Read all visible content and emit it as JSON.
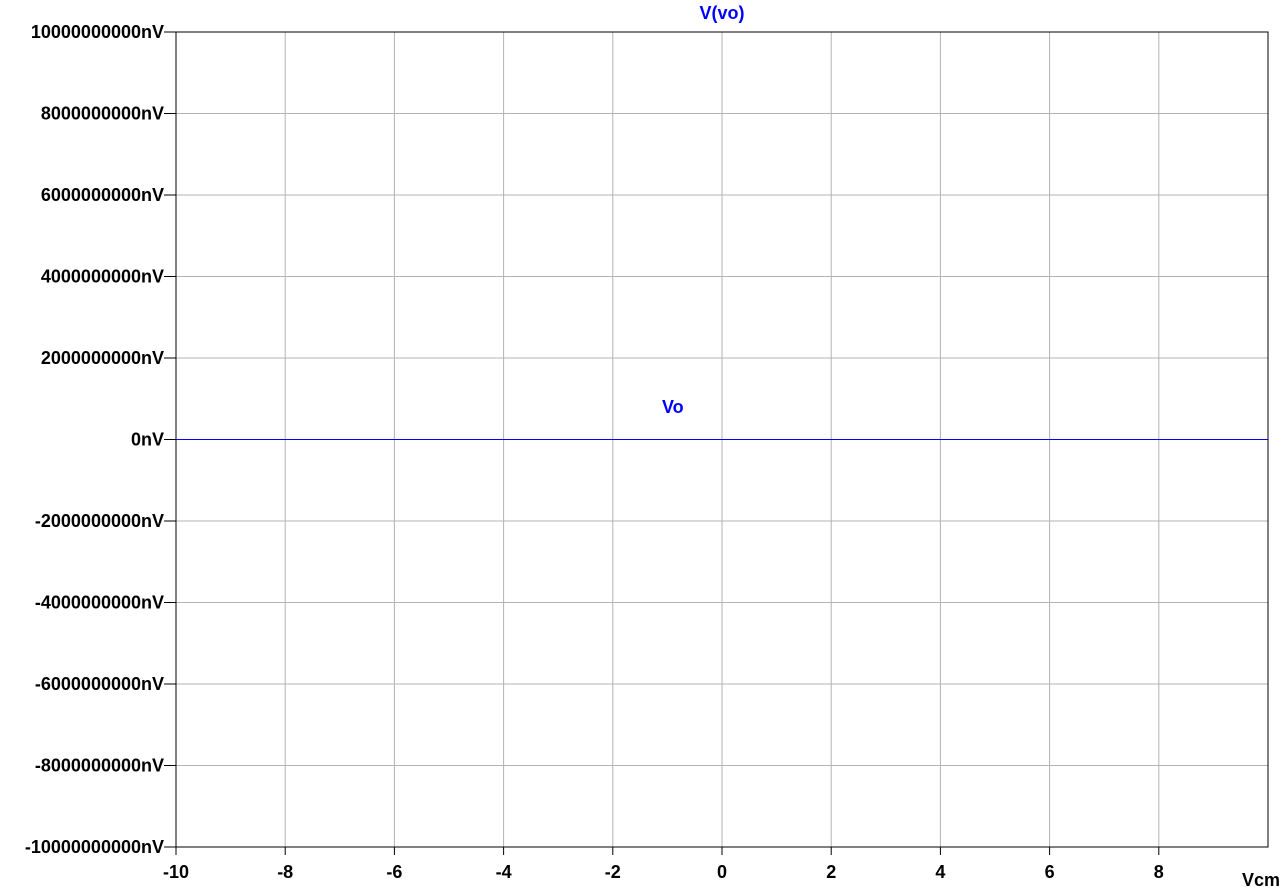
{
  "chart_data": {
    "type": "line",
    "title": "V(vo)",
    "xlabel": "Vcm",
    "ylabel": "",
    "xlim": [
      -10,
      10
    ],
    "ylim": [
      -10000000000,
      10000000000
    ],
    "x_ticks": [
      -10,
      -8,
      -6,
      -4,
      -2,
      0,
      2,
      4,
      6,
      8
    ],
    "x_tick_labels": [
      "-10",
      "-8",
      "-6",
      "-4",
      "-2",
      "0",
      "2",
      "4",
      "6",
      "8"
    ],
    "y_ticks": [
      10000000000,
      8000000000,
      6000000000,
      4000000000,
      2000000000,
      0,
      -2000000000,
      -4000000000,
      -6000000000,
      -8000000000,
      -10000000000
    ],
    "y_tick_labels": [
      "10000000000nV",
      "8000000000nV",
      "6000000000nV",
      "4000000000nV",
      "2000000000nV",
      "0nV",
      "-2000000000nV",
      "-4000000000nV",
      "-6000000000nV",
      "-8000000000nV",
      "-10000000000nV"
    ],
    "grid": true,
    "series": [
      {
        "name": "V(vo)",
        "color": "#0000ff",
        "x": [
          -10,
          10
        ],
        "y": [
          0,
          0
        ]
      }
    ],
    "annotations": [
      {
        "text": "Vo",
        "x": -0.9,
        "y": 800000000,
        "color": "#0000ff"
      }
    ]
  }
}
